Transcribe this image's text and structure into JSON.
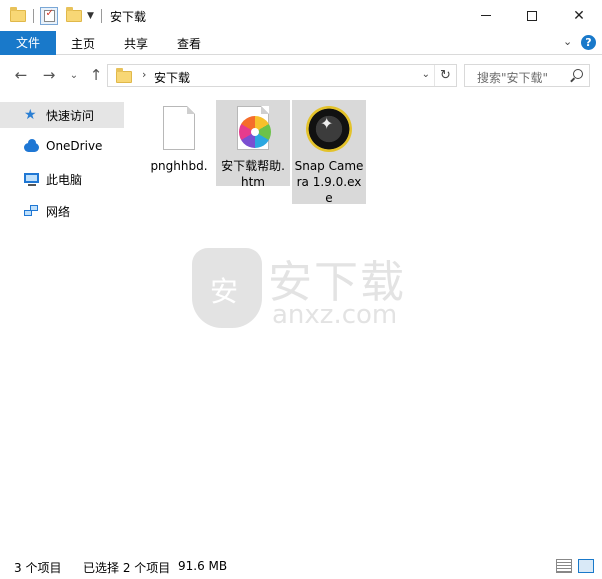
{
  "window": {
    "title": "安下载"
  },
  "ribbon": {
    "tabs": [
      "文件",
      "主页",
      "共享",
      "查看"
    ]
  },
  "address": {
    "crumb": "安下载",
    "search_placeholder": "搜索\"安下载\""
  },
  "nav_pane": {
    "items": [
      {
        "label": "快速访问",
        "icon": "star-icon",
        "selected": true
      },
      {
        "label": "OneDrive",
        "icon": "cloud-icon",
        "selected": false
      },
      {
        "label": "此电脑",
        "icon": "computer-icon",
        "selected": false
      },
      {
        "label": "网络",
        "icon": "network-icon",
        "selected": false
      }
    ]
  },
  "files": [
    {
      "name": "pnghhbd.",
      "icon": "blank-file-icon",
      "selected": false
    },
    {
      "name": "安下载帮助.htm",
      "icon": "htm-file-icon",
      "selected": true
    },
    {
      "name": "Snap Camera 1.9.0.exe",
      "icon": "snap-camera-icon",
      "selected": true
    }
  ],
  "watermark": {
    "big": "安下载",
    "small": "anxz.com"
  },
  "status": {
    "count": "3 个项目",
    "selected": "已选择 2 个项目",
    "size": "91.6 MB"
  },
  "colors": {
    "accent": "#1979ca",
    "selection": "#d9d9d9",
    "nav_selected": "#e5e5e5"
  }
}
